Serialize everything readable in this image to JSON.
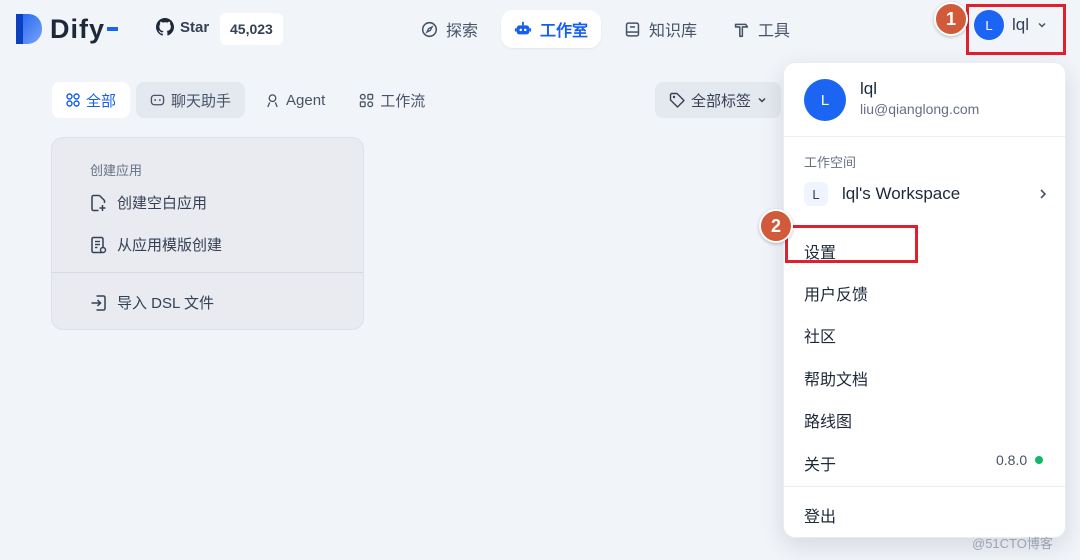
{
  "brand": {
    "name": "Dify",
    "accent": "#1c64f2"
  },
  "github": {
    "label": "Star",
    "count": "45,023",
    "icon": "github-icon"
  },
  "nav": {
    "items": [
      {
        "label": "探索",
        "icon": "compass-icon",
        "active": false
      },
      {
        "label": "工作室",
        "icon": "robot-icon",
        "active": true
      },
      {
        "label": "知识库",
        "icon": "book-icon",
        "active": false
      },
      {
        "label": "工具",
        "icon": "hammer-icon",
        "active": false
      }
    ]
  },
  "user": {
    "initial": "L",
    "name": "lql",
    "email": "liu@qianglong.com"
  },
  "filters": {
    "tabs": [
      {
        "label": "全部",
        "icon": "grid-icon",
        "active": true
      },
      {
        "label": "聊天助手",
        "icon": "chat-icon",
        "active": false
      },
      {
        "label": "Agent",
        "icon": "agent-icon",
        "active": false
      },
      {
        "label": "工作流",
        "icon": "workflow-icon",
        "active": false
      }
    ],
    "tag_label": "全部标签"
  },
  "create_card": {
    "title": "创建应用",
    "items": [
      {
        "label": "创建空白应用",
        "icon": "file-plus-icon"
      },
      {
        "label": "从应用模版创建",
        "icon": "file-template-icon"
      },
      {
        "label": "导入 DSL 文件",
        "icon": "import-icon"
      }
    ]
  },
  "dropdown": {
    "workspace_section": "工作空间",
    "workspace": {
      "initial": "L",
      "name": "lql's Workspace"
    },
    "menu": [
      "设置",
      "用户反馈",
      "社区",
      "帮助文档",
      "路线图",
      "关于"
    ],
    "version": "0.8.0",
    "logout": "登出"
  },
  "annotations": {
    "badge1": "1",
    "badge2": "2",
    "box_color": "#e0202c",
    "badge_color": "#d15a3a"
  },
  "watermark": "@51CTO博客"
}
